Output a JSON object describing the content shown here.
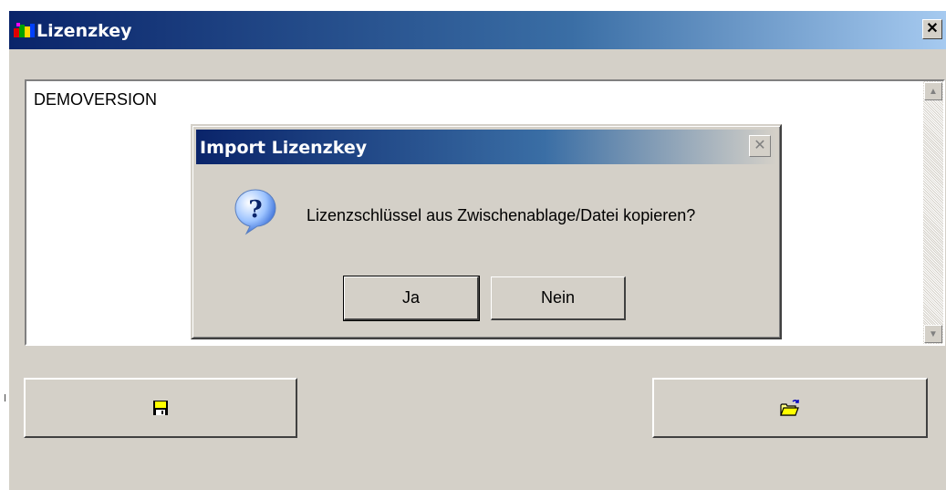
{
  "window": {
    "title": "Lizenzkey",
    "title_icon": "app-colorful-icon",
    "close_label": "✕"
  },
  "license_text": {
    "value": "DEMOVERSION"
  },
  "scrollbar": {
    "up_label": "▲",
    "down_label": "▼"
  },
  "buttons": {
    "save_icon": "floppy-disk-icon",
    "open_icon": "open-folder-icon"
  },
  "dialog": {
    "title": "Import Lizenzkey",
    "close_label": "✕",
    "icon": "question-icon",
    "message": "Lizenzschlüssel aus Zwischenablage/Datei kopieren?",
    "yes_label": "Ja",
    "no_label": "Nein"
  },
  "colors": {
    "titlebar_start": "#0a246a",
    "titlebar_end": "#a6caf0",
    "face": "#d4d0c8"
  }
}
